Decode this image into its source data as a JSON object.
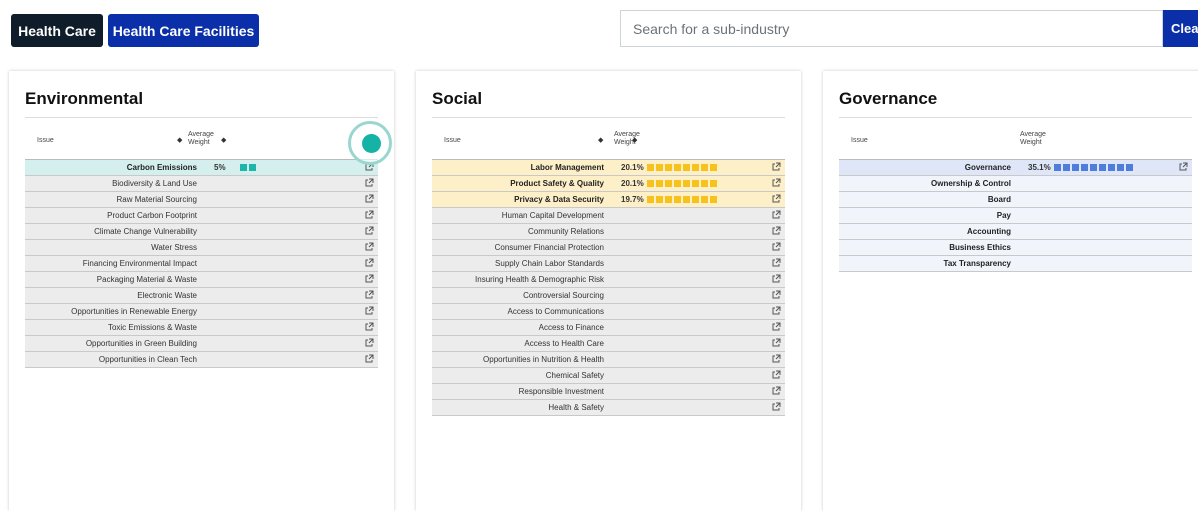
{
  "breadcrumbs": [
    "Health Care",
    "Health Care Facilities"
  ],
  "search": {
    "placeholder": "Search for a sub-industry",
    "value": ""
  },
  "clear_label": "Clear",
  "table_header": {
    "issue": "Issue",
    "average": "Average",
    "weight": "Weight"
  },
  "colors": {
    "environmental": "#1cb5aa",
    "social": "#f6c21b",
    "governance": "#4f7ddb",
    "dark": "#0f1d2a",
    "brand_blue": "#0a2fa8"
  },
  "environmental": {
    "title": "Environmental",
    "rows": [
      {
        "label": "Carbon Emissions",
        "value": "5%",
        "bars": 2,
        "highlight": true,
        "link": true
      },
      {
        "label": "Biodiversity & Land Use",
        "value": "",
        "bars": 0,
        "highlight": false,
        "link": true
      },
      {
        "label": "Raw Material Sourcing",
        "value": "",
        "bars": 0,
        "highlight": false,
        "link": true
      },
      {
        "label": "Product Carbon Footprint",
        "value": "",
        "bars": 0,
        "highlight": false,
        "link": true
      },
      {
        "label": "Climate Change Vulnerability",
        "value": "",
        "bars": 0,
        "highlight": false,
        "link": true
      },
      {
        "label": "Water Stress",
        "value": "",
        "bars": 0,
        "highlight": false,
        "link": true
      },
      {
        "label": "Financing Environmental Impact",
        "value": "",
        "bars": 0,
        "highlight": false,
        "link": true
      },
      {
        "label": "Packaging Material & Waste",
        "value": "",
        "bars": 0,
        "highlight": false,
        "link": true
      },
      {
        "label": "Electronic Waste",
        "value": "",
        "bars": 0,
        "highlight": false,
        "link": true
      },
      {
        "label": "Opportunities in Renewable Energy",
        "value": "",
        "bars": 0,
        "highlight": false,
        "link": true
      },
      {
        "label": "Toxic Emissions & Waste",
        "value": "",
        "bars": 0,
        "highlight": false,
        "link": true
      },
      {
        "label": "Opportunities in Green Building",
        "value": "",
        "bars": 0,
        "highlight": false,
        "link": true
      },
      {
        "label": "Opportunities in Clean Tech",
        "value": "",
        "bars": 0,
        "highlight": false,
        "link": true
      }
    ]
  },
  "social": {
    "title": "Social",
    "rows": [
      {
        "label": "Labor Management",
        "value": "20.1%",
        "bars": 8,
        "highlight": true,
        "link": true
      },
      {
        "label": "Product Safety & Quality",
        "value": "20.1%",
        "bars": 8,
        "highlight": true,
        "link": true
      },
      {
        "label": "Privacy & Data Security",
        "value": "19.7%",
        "bars": 8,
        "highlight": true,
        "link": true
      },
      {
        "label": "Human Capital Development",
        "value": "",
        "bars": 0,
        "highlight": false,
        "link": true
      },
      {
        "label": "Community Relations",
        "value": "",
        "bars": 0,
        "highlight": false,
        "link": true
      },
      {
        "label": "Consumer Financial Protection",
        "value": "",
        "bars": 0,
        "highlight": false,
        "link": true
      },
      {
        "label": "Supply Chain Labor Standards",
        "value": "",
        "bars": 0,
        "highlight": false,
        "link": true
      },
      {
        "label": "Insuring Health & Demographic Risk",
        "value": "",
        "bars": 0,
        "highlight": false,
        "link": true
      },
      {
        "label": "Controversial Sourcing",
        "value": "",
        "bars": 0,
        "highlight": false,
        "link": true
      },
      {
        "label": "Access to Communications",
        "value": "",
        "bars": 0,
        "highlight": false,
        "link": true
      },
      {
        "label": "Access to Finance",
        "value": "",
        "bars": 0,
        "highlight": false,
        "link": true
      },
      {
        "label": "Access to Health Care",
        "value": "",
        "bars": 0,
        "highlight": false,
        "link": true
      },
      {
        "label": "Opportunities in Nutrition & Health",
        "value": "",
        "bars": 0,
        "highlight": false,
        "link": true
      },
      {
        "label": "Chemical Safety",
        "value": "",
        "bars": 0,
        "highlight": false,
        "link": true
      },
      {
        "label": "Responsible Investment",
        "value": "",
        "bars": 0,
        "highlight": false,
        "link": true
      },
      {
        "label": "Health & Safety",
        "value": "",
        "bars": 0,
        "highlight": false,
        "link": true
      }
    ]
  },
  "governance": {
    "title": "Governance",
    "rows": [
      {
        "label": "Governance",
        "value": "35.1%",
        "bars": 9,
        "highlight": true,
        "link": true
      },
      {
        "label": "Ownership & Control",
        "value": "",
        "bars": 0,
        "highlight": false,
        "link": false
      },
      {
        "label": "Board",
        "value": "",
        "bars": 0,
        "highlight": false,
        "link": false
      },
      {
        "label": "Pay",
        "value": "",
        "bars": 0,
        "highlight": false,
        "link": false
      },
      {
        "label": "Accounting",
        "value": "",
        "bars": 0,
        "highlight": false,
        "link": false
      },
      {
        "label": "Business Ethics",
        "value": "",
        "bars": 0,
        "highlight": false,
        "link": false
      },
      {
        "label": "Tax Transparency",
        "value": "",
        "bars": 0,
        "highlight": false,
        "link": false
      }
    ]
  }
}
